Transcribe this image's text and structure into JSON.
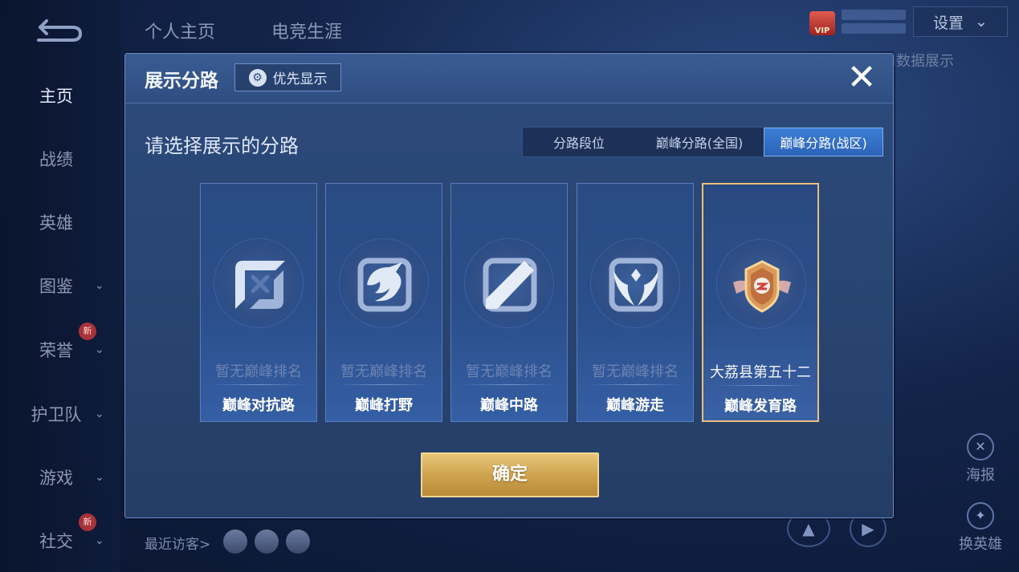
{
  "sidebar": {
    "items": [
      {
        "label": "主页",
        "active": true,
        "chevron": false,
        "new": false
      },
      {
        "label": "战绩",
        "active": false,
        "chevron": false,
        "new": false
      },
      {
        "label": "英雄",
        "active": false,
        "chevron": false,
        "new": false
      },
      {
        "label": "图鉴",
        "active": false,
        "chevron": true,
        "new": false
      },
      {
        "label": "荣誉",
        "active": false,
        "chevron": true,
        "new": true
      },
      {
        "label": "护卫队",
        "active": false,
        "chevron": true,
        "new": false
      },
      {
        "label": "游戏",
        "active": false,
        "chevron": true,
        "new": false
      },
      {
        "label": "社交",
        "active": false,
        "chevron": true,
        "new": true
      }
    ],
    "new_badge": "新",
    "chevron_icon": "chevron-down-icon"
  },
  "top_tabs": [
    "个人主页",
    "电竞生涯"
  ],
  "settings": {
    "label": "设置"
  },
  "vip": {
    "badge": "VIP"
  },
  "background_hint": "定和数据展示",
  "right_buttons": [
    {
      "label": "海报",
      "icon": "poster-icon"
    },
    {
      "label": "换英雄",
      "icon": "swap-hero-icon"
    }
  ],
  "recent_visitors": {
    "label": "最近访客>"
  },
  "modal": {
    "title": "展示分路",
    "priority_button": {
      "label": "优先显示",
      "icon": "gear-icon"
    },
    "prompt": "请选择展示的分路",
    "tabs": [
      {
        "label": "分路段位",
        "active": false
      },
      {
        "label": "巅峰分路(全国)",
        "active": false
      },
      {
        "label": "巅峰分路(战区)",
        "active": true
      }
    ],
    "cards": [
      {
        "rank": "暂无巅峰排名",
        "name": "巅峰对抗路",
        "icon": "clash-lane-icon",
        "selected": false
      },
      {
        "rank": "暂无巅峰排名",
        "name": "巅峰打野",
        "icon": "jungle-dragon-icon",
        "selected": false
      },
      {
        "rank": "暂无巅峰排名",
        "name": "巅峰中路",
        "icon": "mid-lane-icon",
        "selected": false
      },
      {
        "rank": "暂无巅峰排名",
        "name": "巅峰游走",
        "icon": "roam-wings-icon",
        "selected": false
      },
      {
        "rank": "大荔县第五十二",
        "name": "巅峰发育路",
        "icon": "farm-lane-badge-icon",
        "selected": true
      }
    ],
    "confirm_label": "确定",
    "colors": {
      "accent_blue": "#2c63b7",
      "gold": "#cfa44f",
      "selected_border": "#e8c07a"
    }
  }
}
